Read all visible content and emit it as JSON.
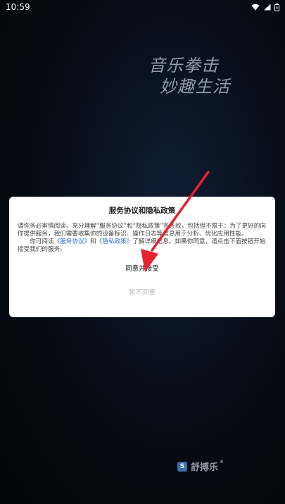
{
  "status_bar": {
    "time": "10:59"
  },
  "background": {
    "slogan_line1": "音乐拳击",
    "slogan_line2": "妙趣生活"
  },
  "dialog": {
    "title": "服务协议和隐私政策",
    "paragraph1": "请你务必审慎阅读、充分理解“服务协议”和“隐私政策”各条款，包括但不限于：为了更好的向你提供服务，我们需要收集你的设备标识、操作日志等信息用于分析、优化应用性能。",
    "p2_prefix": "你可阅读",
    "link_service": "《服务协议》",
    "p2_and": "和",
    "link_privacy": "《隐私政策》",
    "p2_suffix": "了解详细信息。如果你同意，请点击下面按钮开始接受我们的服务。",
    "agree_label": "同意并接受",
    "decline_label": "暂不同意"
  },
  "brand": {
    "logo_glyph": "S",
    "name": "舒搏乐",
    "reg": "®"
  },
  "colors": {
    "link": "#2b6cd8",
    "arrow": "#e8202f"
  }
}
